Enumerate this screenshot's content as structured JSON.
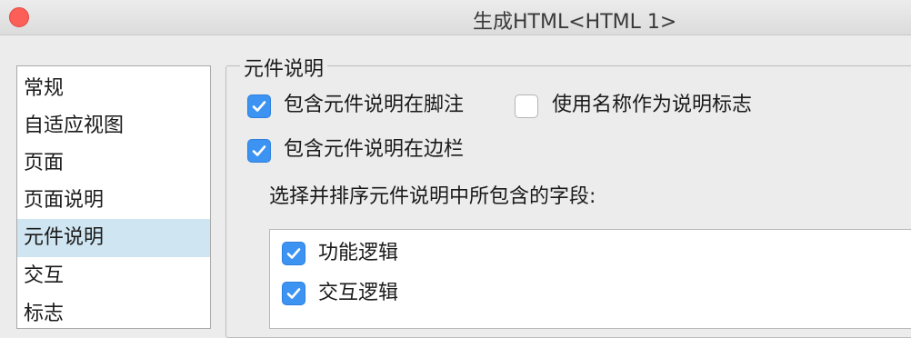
{
  "window": {
    "title": "生成HTML<HTML 1>"
  },
  "sidebar": {
    "items": [
      {
        "label": "常规",
        "selected": false
      },
      {
        "label": "自适应视图",
        "selected": false
      },
      {
        "label": "页面",
        "selected": false
      },
      {
        "label": "页面说明",
        "selected": false
      },
      {
        "label": "元件说明",
        "selected": true
      },
      {
        "label": "交互",
        "selected": false
      },
      {
        "label": "标志",
        "selected": false
      }
    ]
  },
  "panel": {
    "group_title": "元件说明",
    "include_in_footnote": {
      "label": "包含元件说明在脚注",
      "checked": true
    },
    "use_name_as_marker": {
      "label": "使用名称作为说明标志",
      "checked": false
    },
    "include_in_margin": {
      "label": "包含元件说明在边栏",
      "checked": true
    },
    "fields_prompt": "选择并排序元件说明中所包含的字段:",
    "fields": [
      {
        "label": "功能逻辑",
        "checked": true
      },
      {
        "label": "交互逻辑",
        "checked": true
      }
    ]
  },
  "colors": {
    "accent": "#3c93f2",
    "selection": "#cfe5f1",
    "close": "#fc5f57"
  },
  "icons": {
    "checkbox_checked": "checkmark-icon"
  }
}
